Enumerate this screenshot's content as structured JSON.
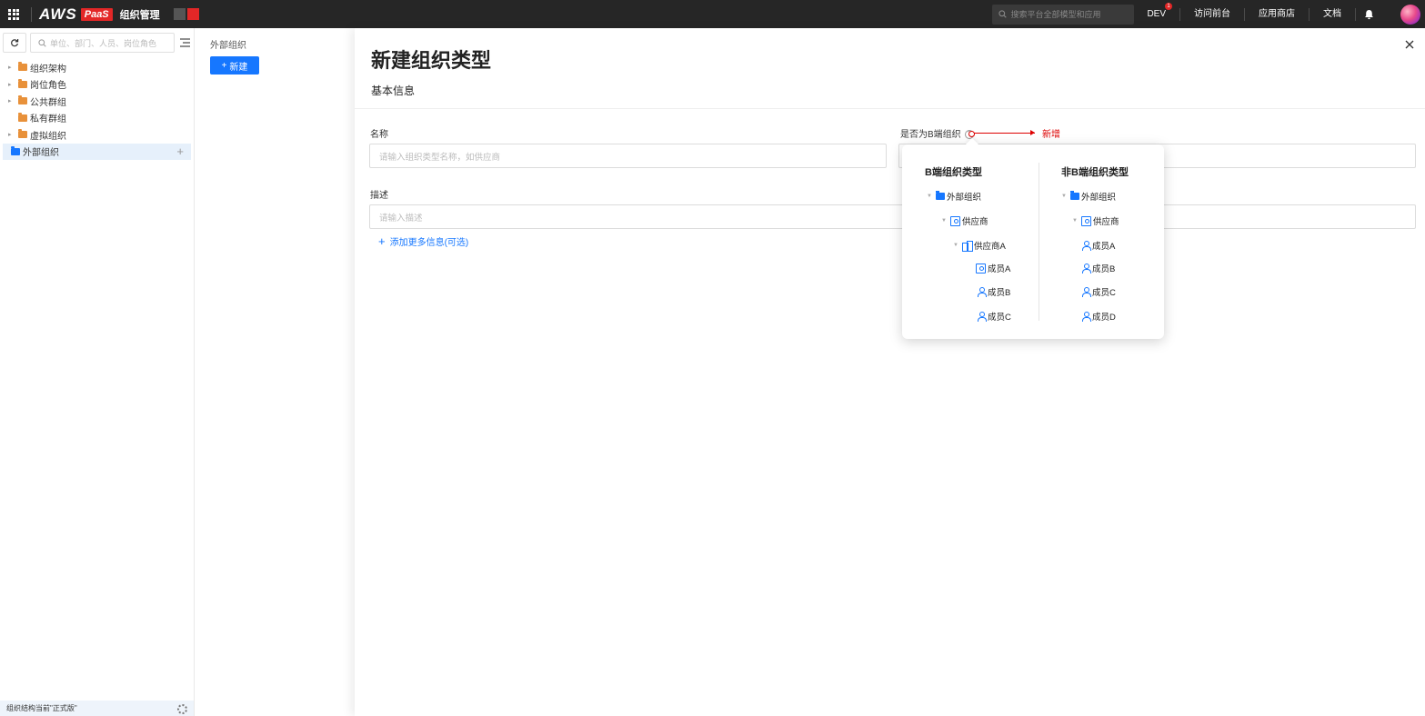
{
  "topbar": {
    "logo_aws": "AWS",
    "logo_paas": "PaaS",
    "title": "组织管理",
    "swatch_colors": [
      "#555555",
      "#e32727"
    ],
    "search_placeholder": "搜索平台全部模型和应用",
    "dev_label": "DEV",
    "dev_badge": "1",
    "links": [
      "访问前台",
      "应用商店",
      "文档"
    ]
  },
  "sidebar": {
    "search_placeholder": "单位、部门、人员、岗位角色",
    "items": [
      {
        "label": "组织架构",
        "caret": true
      },
      {
        "label": "岗位角色",
        "caret": true
      },
      {
        "label": "公共群组",
        "caret": true
      },
      {
        "label": "私有群组",
        "caret": false
      },
      {
        "label": "虚拟组织",
        "caret": true
      },
      {
        "label": "外部组织",
        "caret": false,
        "active": true
      }
    ],
    "footer": "组织结构当前\"正式版\""
  },
  "middle": {
    "title": "外部组织",
    "new_button": "新建"
  },
  "drawer": {
    "title": "新建组织类型",
    "section": "基本信息",
    "name_label": "名称",
    "name_placeholder": "请输入组织类型名称，如供应商",
    "b_label": "是否为B端组织",
    "annotation": "新增",
    "desc_label": "描述",
    "desc_placeholder": "请输入描述",
    "add_more": "添加更多信息(可选)"
  },
  "popover": {
    "left": {
      "title": "B端组织类型",
      "root": "外部组织",
      "child": "供应商",
      "grandchild": "供应商A",
      "members": [
        "成员A",
        "成员B",
        "成员C"
      ]
    },
    "right": {
      "title": "非B端组织类型",
      "root": "外部组织",
      "child": "供应商",
      "members": [
        "成员A",
        "成员B",
        "成员C",
        "成员D"
      ]
    }
  }
}
